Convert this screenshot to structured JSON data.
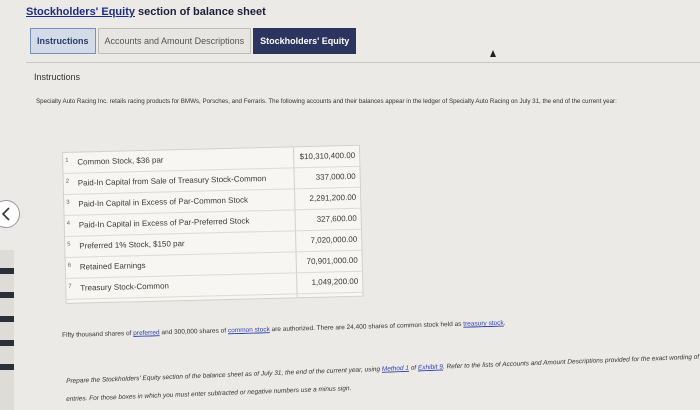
{
  "title": {
    "part1": "Stockholders' Equity",
    "part2": " section of balance sheet"
  },
  "tabs": [
    {
      "label": "Instructions"
    },
    {
      "label": "Accounts and Amount Descriptions"
    },
    {
      "label": "Stockholders' Equity"
    }
  ],
  "instructions": {
    "heading": "Instructions",
    "intro": "Specialty Auto Racing Inc. retails racing products for BMWs, Porsches, and Ferraris. The following accounts and their balances appear in the ledger of Specialty Auto Racing on July 31, the end of the current year:"
  },
  "accounts": [
    {
      "num": "1",
      "name": "Common Stock, $36 par",
      "amount": "$10,310,400.00"
    },
    {
      "num": "2",
      "name": "Paid-In Capital from Sale of Treasury Stock-Common",
      "amount": "337,000.00"
    },
    {
      "num": "3",
      "name": "Paid-In Capital in Excess of Par-Common Stock",
      "amount": "2,291,200.00"
    },
    {
      "num": "4",
      "name": "Paid-In Capital in Excess of Par-Preferred Stock",
      "amount": "327,600.00"
    },
    {
      "num": "5",
      "name": "Preferred 1% Stock, $150 par",
      "amount": "7,020,000.00"
    },
    {
      "num": "6",
      "name": "Retained Earnings",
      "amount": "70,901,000.00"
    },
    {
      "num": "7",
      "name": "Treasury Stock-Common",
      "amount": "1,049,200.00"
    }
  ],
  "fifty": {
    "t1": "Fifty thousand shares of ",
    "link1": "preferred",
    "t2": " and 300,000 shares of ",
    "link2": "common stock",
    "t3": " are authorized. There are 24,400 shares of common stock held as ",
    "link3": "treasury stock",
    "t4": "."
  },
  "prepare": {
    "t1": "Prepare the Stockholders' Equity section of the balance sheet as of July 31, the end of the current year, using ",
    "link1": "Method 1",
    "t2": " of ",
    "link2": "Exhibit 9",
    "t3": ". Refer to the lists of Accounts and Amount Descriptions provided for the exact wording of",
    "t4": "entries. For those boxes in which you must enter subtracted or negative numbers use a minus sign."
  }
}
